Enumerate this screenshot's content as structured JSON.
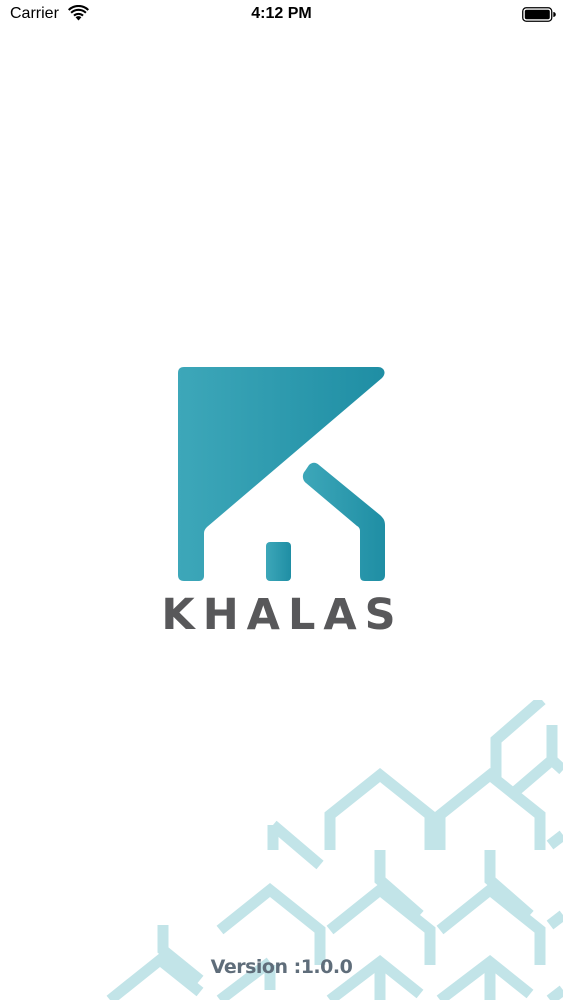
{
  "status_bar": {
    "carrier": "Carrier",
    "time": "4:12 PM",
    "wifi_icon": "wifi-icon",
    "battery_icon": "battery-full-icon"
  },
  "splash": {
    "logo_icon": "house-logo-icon",
    "brand_name": "KHALAS",
    "version": "Version :1.0.0",
    "pattern": "house-pattern-decoration"
  },
  "colors": {
    "brand_teal_light": "#3da7b9",
    "brand_teal_dark": "#1f8ea4",
    "brand_text": "#58585a",
    "pattern": "#c2e4e8",
    "version_text": "#5f6d7a"
  }
}
